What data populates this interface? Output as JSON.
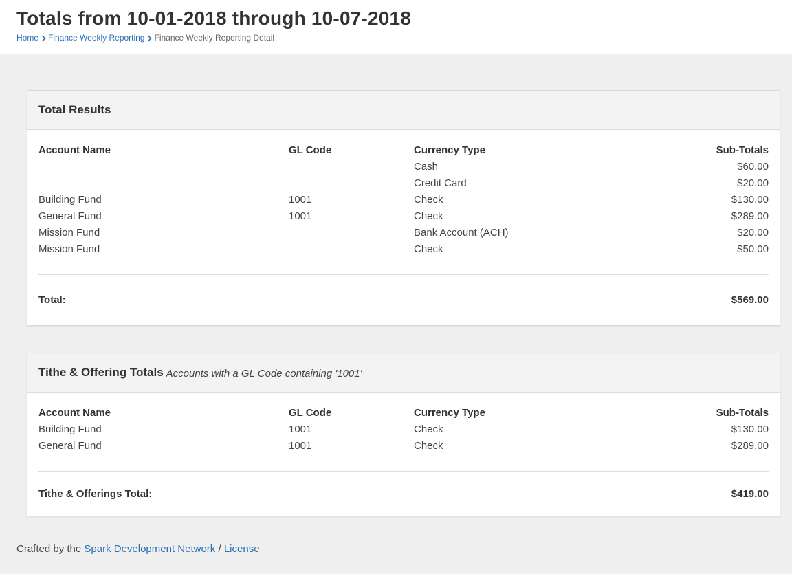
{
  "header": {
    "title": "Totals from 10-01-2018 through 10-07-2018",
    "breadcrumbs": [
      "Home",
      "Finance Weekly Reporting",
      "Finance Weekly Reporting Detail"
    ]
  },
  "total_results": {
    "title": "Total Results",
    "columns": [
      "Account Name",
      "GL Code",
      "Currency Type",
      "Sub-Totals"
    ],
    "rows": [
      [
        "",
        "",
        "Cash",
        "$60.00"
      ],
      [
        "",
        "",
        "Credit Card",
        "$20.00"
      ],
      [
        "Building Fund",
        "1001",
        "Check",
        "$130.00"
      ],
      [
        "General Fund",
        "1001",
        "Check",
        "$289.00"
      ],
      [
        "Mission Fund",
        "",
        "Bank Account (ACH)",
        "$20.00"
      ],
      [
        "Mission Fund",
        "",
        "Check",
        "$50.00"
      ]
    ],
    "total_label": "Total:",
    "total_value": "$569.00"
  },
  "tithe_totals": {
    "title": "Tithe & Offering Totals",
    "subtitle": "Accounts with a GL Code containing '1001'",
    "columns": [
      "Account Name",
      "GL Code",
      "Currency Type",
      "Sub-Totals"
    ],
    "rows": [
      [
        "Building Fund",
        "1001",
        "Check",
        "$130.00"
      ],
      [
        "General Fund",
        "1001",
        "Check",
        "$289.00"
      ]
    ],
    "total_label": "Tithe & Offerings Total:",
    "total_value": "$419.00"
  },
  "footer": {
    "prefix": "Crafted by the",
    "link_text": "Spark Development Network",
    "separator": "/",
    "license_text": "License"
  },
  "colors": {
    "link": "#2a6fb6",
    "background": "#efefef",
    "panel_heading": "#f3f3f3"
  }
}
